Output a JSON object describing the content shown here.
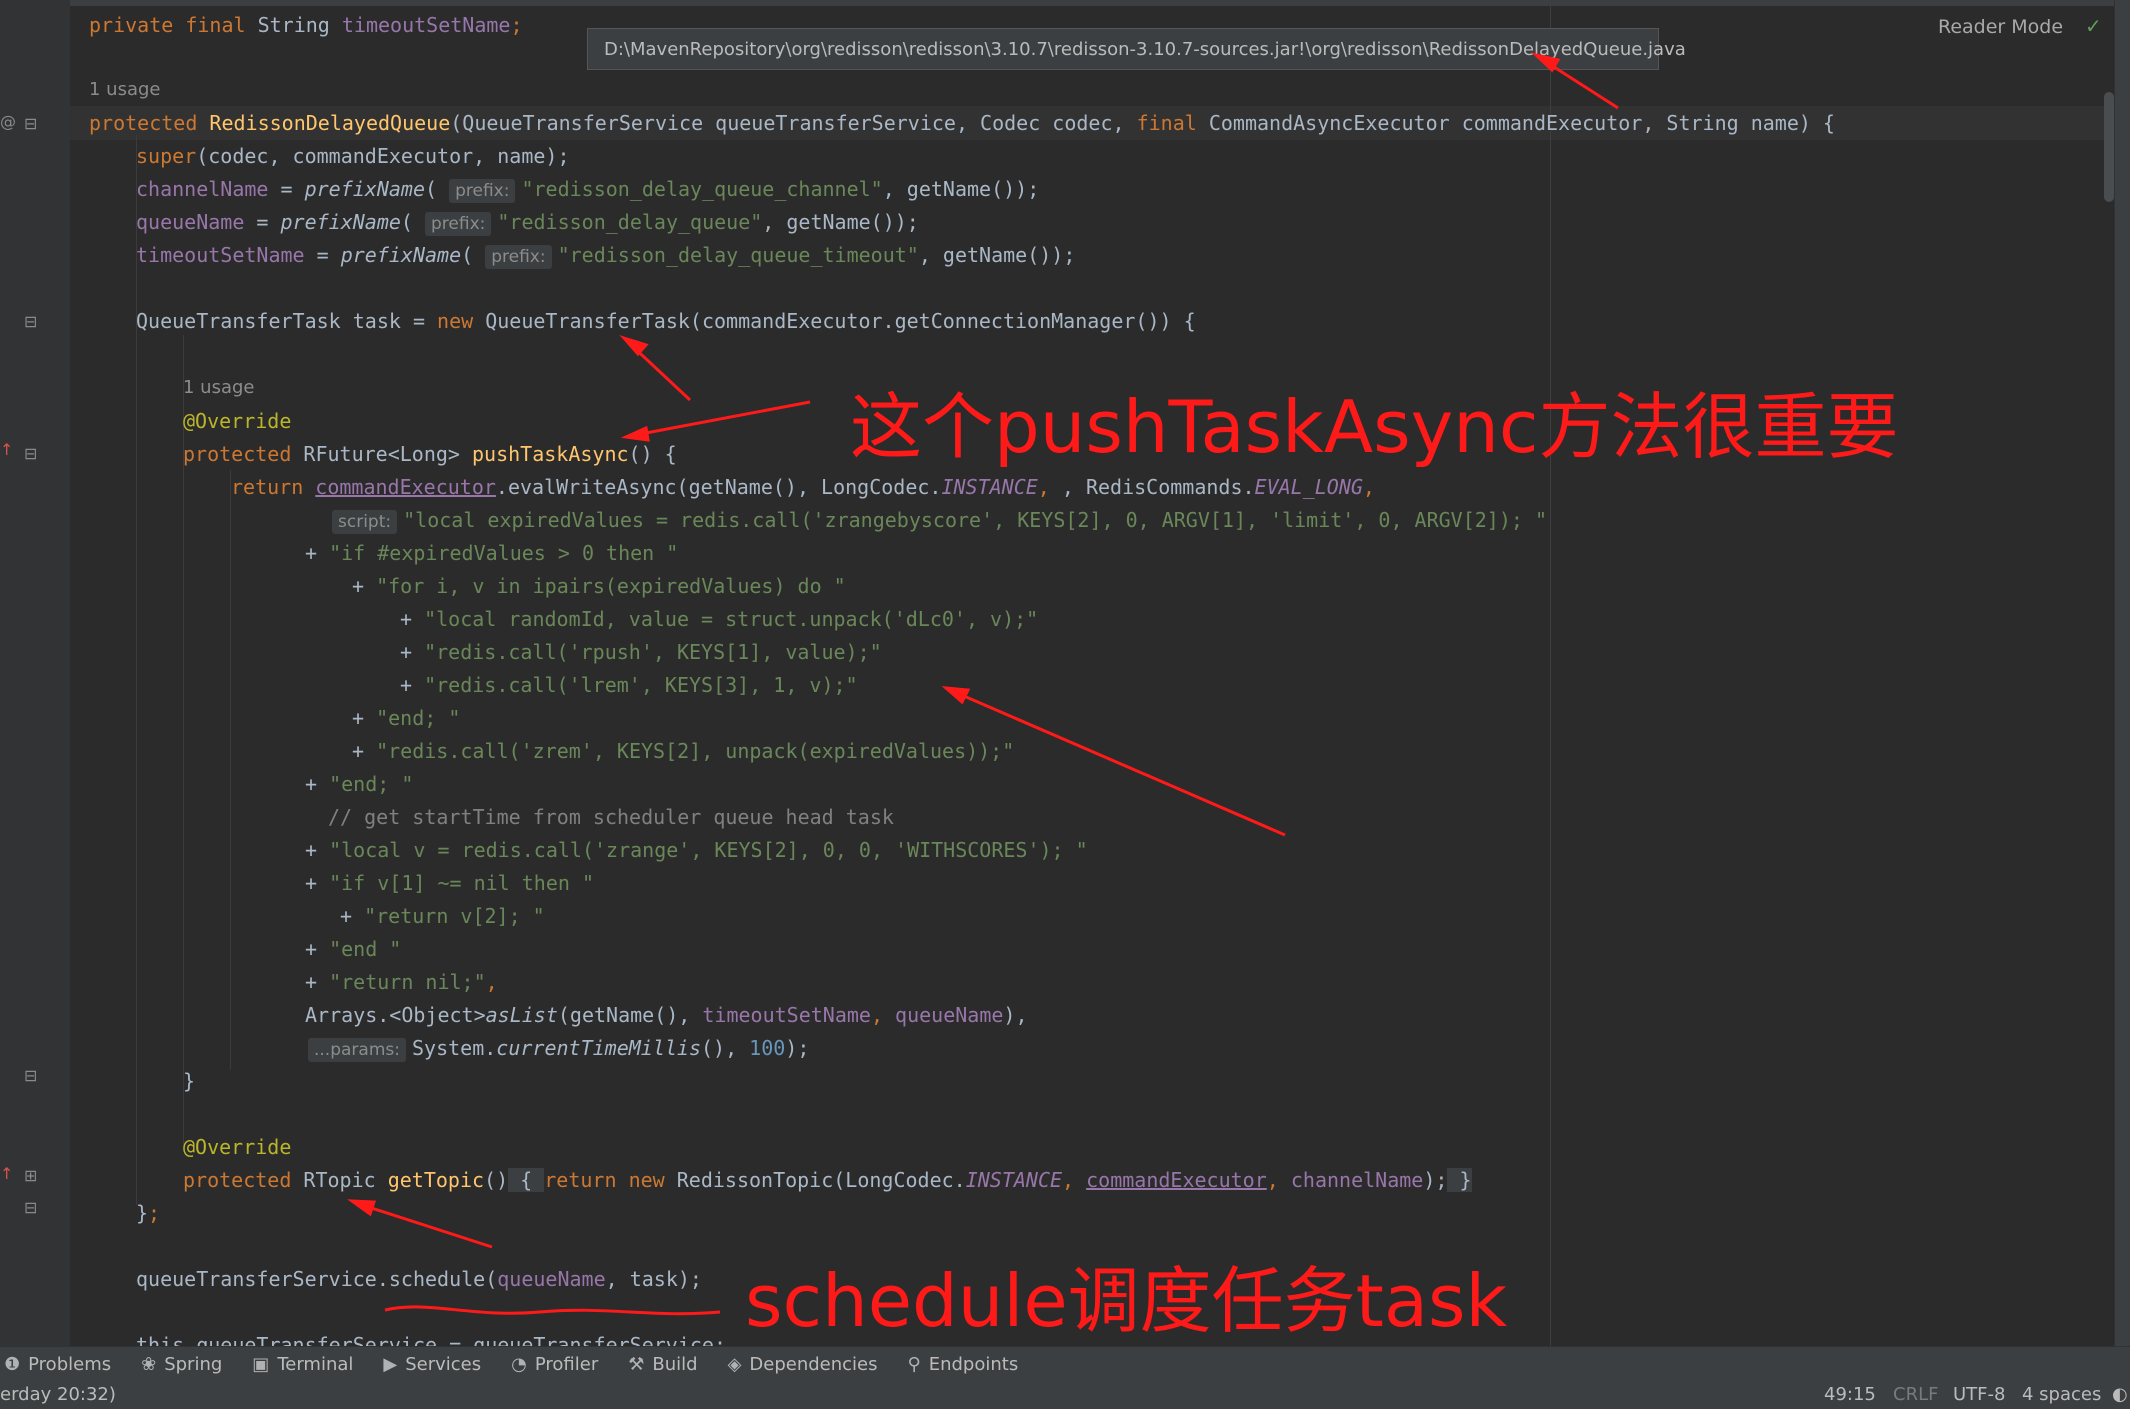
{
  "tooltip": {
    "path": "D:\\MavenRepository\\org\\redisson\\redisson\\3.10.7\\redisson-3.10.7-sources.jar!\\org\\redisson\\RedissonDelayedQueue.java"
  },
  "header": {
    "reader_mode": "Reader Mode"
  },
  "usages": {
    "constructor": "1 usage",
    "push_task": "1 usage"
  },
  "hints": {
    "prefix": "prefix:",
    "script": "script:",
    "params": "...params:"
  },
  "code": {
    "l1_kw": "private final ",
    "l1_type": "String ",
    "l1_field": "timeoutSetName",
    "l1_end": ";",
    "ctor_kw": "protected ",
    "ctor_name": "RedissonDelayedQueue",
    "ctor_args_a": "(QueueTransferService queueTransferService, Codec codec, ",
    "ctor_final": "final ",
    "ctor_args_b": "CommandAsyncExecutor commandExecutor, String name) {",
    "super_kw": "super",
    "super_args": "(codec, commandExecutor, name);",
    "channel_field": "channelName",
    "channel_assign": " = ",
    "prefix_fn": "prefixName",
    "channel_str": "\"redisson_delay_queue_channel\"",
    "getname_tail": ", getName());",
    "queue_field": "queueName",
    "queue_str": "\"redisson_delay_queue\"",
    "timeout_field": "timeoutSetName",
    "timeout_str": "\"redisson_delay_queue_timeout\"",
    "task_decl": "QueueTransferTask task = ",
    "new_kw": "new ",
    "task_ctor": "QueueTransferTask(commandExecutor.getConnectionManager()) {",
    "override": "@Override",
    "push_kw": "protected ",
    "push_type": "RFuture<Long> ",
    "push_name": "pushTaskAsync",
    "push_end": "() {",
    "return_kw": "return ",
    "cmd_exec": "commandExecutor",
    "eval_call": ".evalWriteAsync(getName(), LongCodec.",
    "instance": "INSTANCE",
    "redis_cmds": ", RedisCommands.",
    "eval_long": "EVAL_LONG",
    "comma": ",",
    "lua1": "\"local expiredValues = redis.call('zrangebyscore', KEYS[2], 0, ARGV[1], 'limit', 0, ARGV[2]); \"",
    "lua2": "\"if #expiredValues > 0 then \"",
    "lua3": "\"for i, v in ipairs(expiredValues) do \"",
    "lua4": "\"local randomId, value = struct.unpack('dLc0', v);\"",
    "lua5": "\"redis.call('rpush', KEYS[1], value);\"",
    "lua6": "\"redis.call('lrem', KEYS[3], 1, v);\"",
    "lua7": "\"end; \"",
    "lua8": "\"redis.call('zrem', KEYS[2], unpack(expiredValues));\"",
    "lua9": "\"end; \"",
    "comment": "// get startTime from scheduler queue head task",
    "lua10": "\"local v = redis.call('zrange', KEYS[2], 0, 0, 'WITHSCORES'); \"",
    "lua11": "\"if v[1] ~= nil then \"",
    "lua12": "\"return v[2]; \"",
    "lua13": "\"end \"",
    "lua14": "\"return nil;\"",
    "plus": "+ ",
    "arrays_a": "Arrays.<Object>",
    "as_list": "asList",
    "arrays_b": "(getName(), ",
    "arrays_f1": "timeoutSetName",
    "arrays_sep": ", ",
    "arrays_f2": "queueName",
    "arrays_end": "),",
    "sys_a": "System.",
    "sys_fn": "currentTimeMillis",
    "sys_b": "(), ",
    "hundred": "100",
    "sys_end": ");",
    "close_brace": "}",
    "topic_kw": "protected ",
    "topic_type": "RTopic ",
    "topic_name": "getTopic",
    "topic_paren": "()",
    "topic_open": " { ",
    "topic_return": "return ",
    "topic_new": "new ",
    "topic_body": "RedissonTopic(LongCodec.",
    "topic_instance": "INSTANCE",
    "topic_sep": ", ",
    "topic_exec": "commandExecutor",
    "topic_field": "channelName",
    "topic_close": ");",
    "topic_end": " }",
    "class_end_brace": "}",
    "class_end_semi": ";",
    "sched_a": "queueTransferService.schedule(",
    "sched_field": "queueName",
    "sched_b": ", task);",
    "partial": "this.queueTransferService = queueTransferService;"
  },
  "annotations": {
    "push_note": "这个pushTaskAsync方法很重要",
    "schedule_note": "schedule调度任务task"
  },
  "toolwindows": [
    {
      "icon": "problems-icon",
      "label": "Problems"
    },
    {
      "icon": "spring-icon",
      "label": "Spring"
    },
    {
      "icon": "terminal-icon",
      "label": "Terminal"
    },
    {
      "icon": "services-icon",
      "label": "Services"
    },
    {
      "icon": "profiler-icon",
      "label": "Profiler"
    },
    {
      "icon": "build-icon",
      "label": "Build"
    },
    {
      "icon": "dependencies-icon",
      "label": "Dependencies"
    },
    {
      "icon": "endpoints-icon",
      "label": "Endpoints"
    }
  ],
  "status": {
    "left": "erday 20:32)",
    "position": "49:15",
    "line_sep": "CRLF",
    "encoding": "UTF-8",
    "indent": "4 spaces"
  },
  "colors": {
    "annotation_red": "#ff1a1a",
    "keyword": "#cc7832",
    "string": "#6a8759",
    "field": "#9876aa",
    "method": "#ffc66d"
  }
}
